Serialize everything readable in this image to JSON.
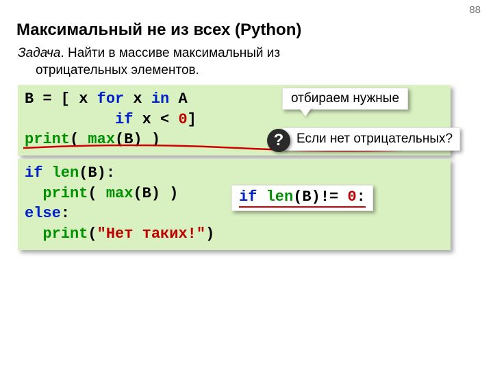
{
  "page_number": "88",
  "title": "Максимальный не из всех (Python)",
  "task": {
    "prefix": "Задача",
    "line1_rest": ". Найти в массиве максимальный из",
    "line2": "отрицательных элементов."
  },
  "code1": {
    "l1": {
      "a": "B = [ x ",
      "b": "for",
      "c": " x ",
      "d": "in",
      "e": " A"
    },
    "l2": {
      "a": "          ",
      "b": "if",
      "c": " x < ",
      "d": "0",
      "e": "]"
    },
    "l3": {
      "a": "print",
      "b": "( ",
      "c": "max",
      "d": "(B) )"
    }
  },
  "code2": {
    "l1": {
      "a": "if",
      "b": " ",
      "c": "len",
      "d": "(B):"
    },
    "l2": {
      "a": "  ",
      "b": "print",
      "c": "( ",
      "d": "max",
      "e": "(B) )"
    },
    "l3": {
      "a": "else",
      "b": ":"
    },
    "l4": {
      "a": "  ",
      "b": "print",
      "c": "(",
      "d": "\"Нет таких!\"",
      "e": ")"
    }
  },
  "callout1": "отбираем нужные",
  "question_mark": "?",
  "callout2": "Если нет отрицательных?",
  "inline_fix": {
    "a": "if",
    "b": " ",
    "c": "len",
    "d": "(B)!= ",
    "e": "0",
    "f": ":"
  }
}
